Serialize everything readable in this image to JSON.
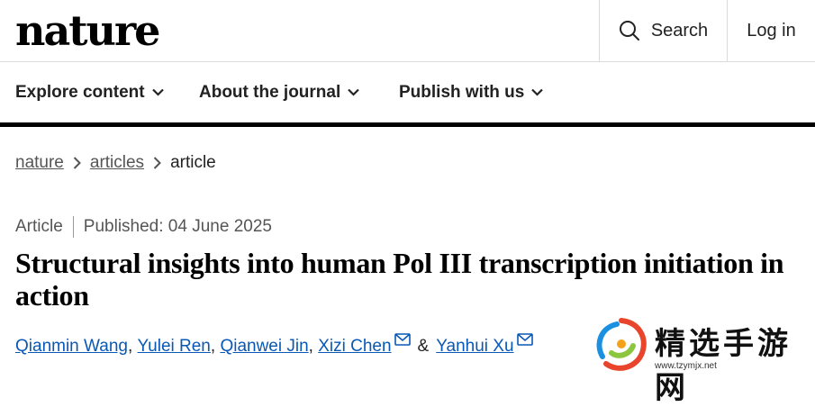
{
  "header": {
    "logo": "nature",
    "search_label": "Search",
    "login_label": "Log in"
  },
  "nav": {
    "items": [
      {
        "label": "Explore content"
      },
      {
        "label": "About the journal"
      },
      {
        "label": "Publish with us"
      }
    ]
  },
  "breadcrumb": {
    "items": [
      "nature",
      "articles",
      "article"
    ]
  },
  "article": {
    "type": "Article",
    "published": "Published: 04 June 2025",
    "title": "Structural insights into human Pol III transcription initiation in action",
    "authors": [
      "Qianmin Wang",
      "Yulei Ren",
      "Qianwei Jin",
      "Xizi Chen",
      "Yanhui Xu"
    ],
    "and": "&"
  },
  "watermark": {
    "text": "精选手游网",
    "url": "www.tzymjx.net"
  },
  "colors": {
    "link": "#0a58b5",
    "nav_border": "#000000"
  }
}
